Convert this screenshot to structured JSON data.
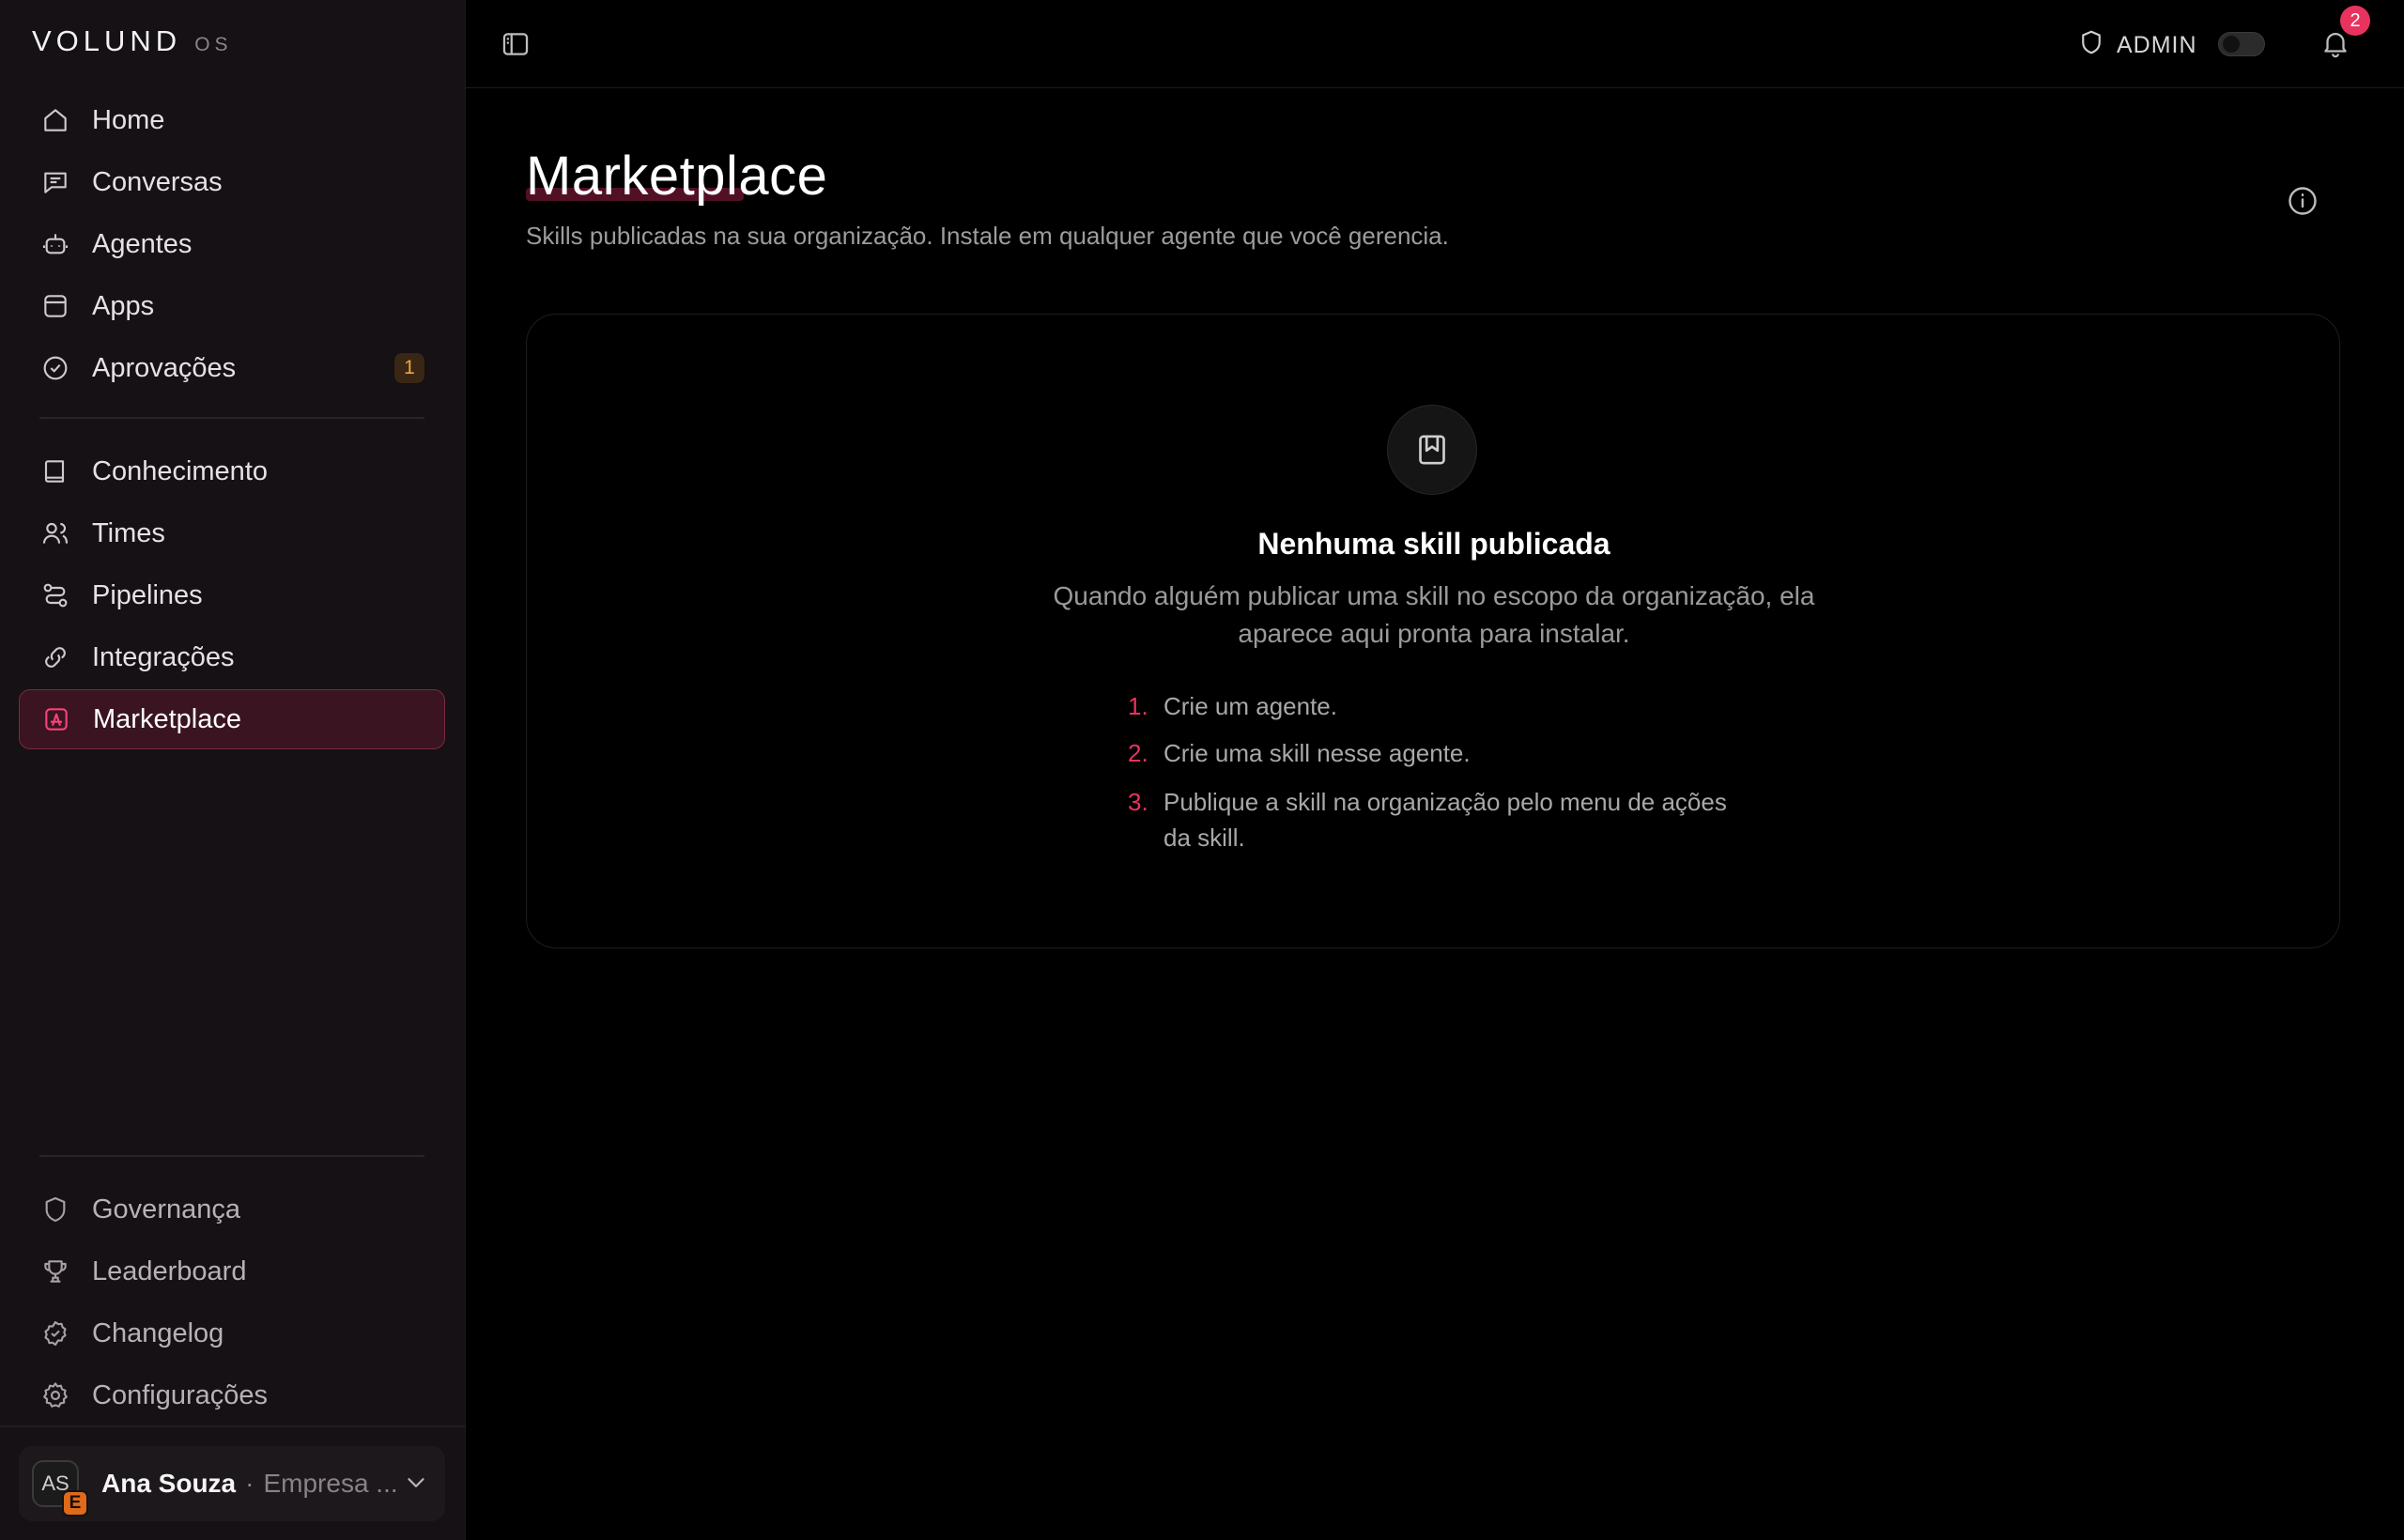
{
  "brand": {
    "name": "VOLUND",
    "suffix": "OS"
  },
  "sidebar": {
    "primary": [
      {
        "label": "Home",
        "icon": "home-icon"
      },
      {
        "label": "Conversas",
        "icon": "chat-icon"
      },
      {
        "label": "Agentes",
        "icon": "bot-icon"
      },
      {
        "label": "Apps",
        "icon": "app-window-icon"
      },
      {
        "label": "Aprovações",
        "icon": "check-circle-icon",
        "badge": "1"
      }
    ],
    "knowledge": [
      {
        "label": "Conhecimento",
        "icon": "book-icon"
      },
      {
        "label": "Times",
        "icon": "users-icon"
      },
      {
        "label": "Pipelines",
        "icon": "route-icon"
      },
      {
        "label": "Integrações",
        "icon": "link-icon"
      },
      {
        "label": "Marketplace",
        "icon": "marketplace-icon",
        "active": true
      }
    ],
    "secondary": [
      {
        "label": "Governança",
        "icon": "shield-icon"
      },
      {
        "label": "Leaderboard",
        "icon": "trophy-icon"
      },
      {
        "label": "Changelog",
        "icon": "badge-check-icon"
      },
      {
        "label": "Configurações",
        "icon": "gear-icon"
      }
    ],
    "user": {
      "initials": "AS",
      "org_initial": "E",
      "name": "Ana Souza",
      "separator": "·",
      "org": "Empresa ..."
    }
  },
  "topbar": {
    "role": "ADMIN",
    "notifications_count": "2"
  },
  "page": {
    "title": "Marketplace",
    "subtitle": "Skills publicadas na sua organização. Instale em qualquer agente que você gerencia."
  },
  "empty_state": {
    "title": "Nenhuma skill publicada",
    "description": "Quando alguém publicar uma skill no escopo da organização, ela aparece aqui pronta para instalar.",
    "steps": [
      {
        "num": "1.",
        "text": "Crie um agente."
      },
      {
        "num": "2.",
        "text": "Crie uma skill nesse agente."
      },
      {
        "num": "3.",
        "text": "Publique a skill na organização pelo menu de ações da skill."
      }
    ]
  },
  "colors": {
    "accent": "#e8335f",
    "active_bg": "#3a1420",
    "sidebar_bg": "#151114",
    "badge_text": "#f0a547"
  }
}
